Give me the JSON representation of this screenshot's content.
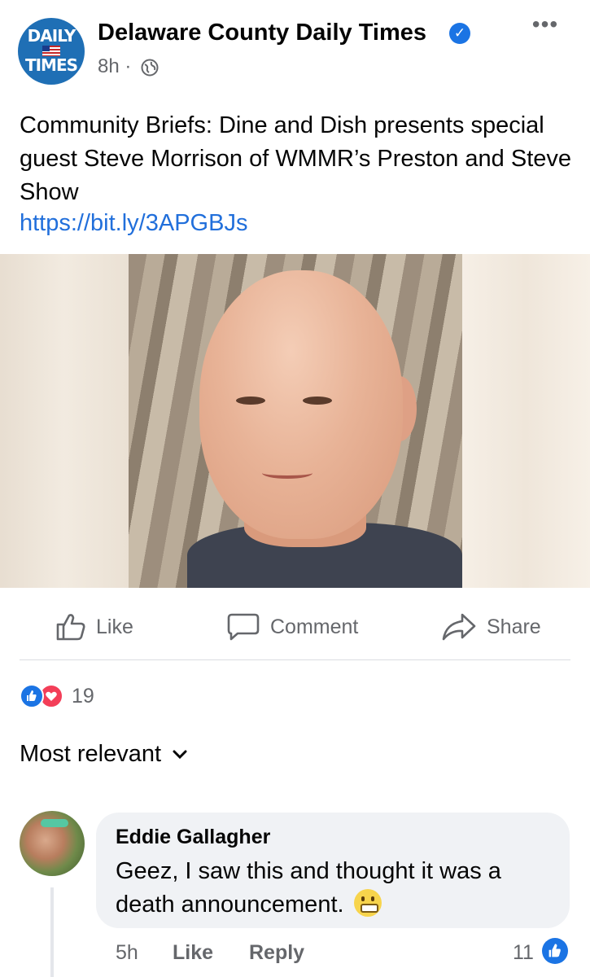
{
  "post": {
    "page_name": "Delaware County Daily Times",
    "logo_top": "DAILY",
    "logo_bottom": "TIMES",
    "time": "8h ·",
    "text": "Community Briefs: Dine and Dish presents special guest Steve Morrison of WMMR’s Preston and Steve Show",
    "link": "https://bit.ly/3APGBJs",
    "verified_icon": "verified-badge-icon",
    "privacy_icon": "globe-icon"
  },
  "actions": {
    "like": "Like",
    "comment": "Comment",
    "share": "Share"
  },
  "reactions": {
    "count": "19",
    "types": [
      "like",
      "love"
    ]
  },
  "comments_sort": {
    "label": "Most relevant"
  },
  "comment": {
    "author": "Eddie Gallagher",
    "text": "Geez, I saw this and thought it was a death announcement.",
    "time": "5h",
    "like_label": "Like",
    "reply_label": "Reply",
    "reaction_count": "11"
  },
  "colors": {
    "link": "#216fdb",
    "like_blue": "#1b74e4",
    "love_red": "#f33e58",
    "muted": "#65676b",
    "bubble": "#f0f2f5"
  }
}
